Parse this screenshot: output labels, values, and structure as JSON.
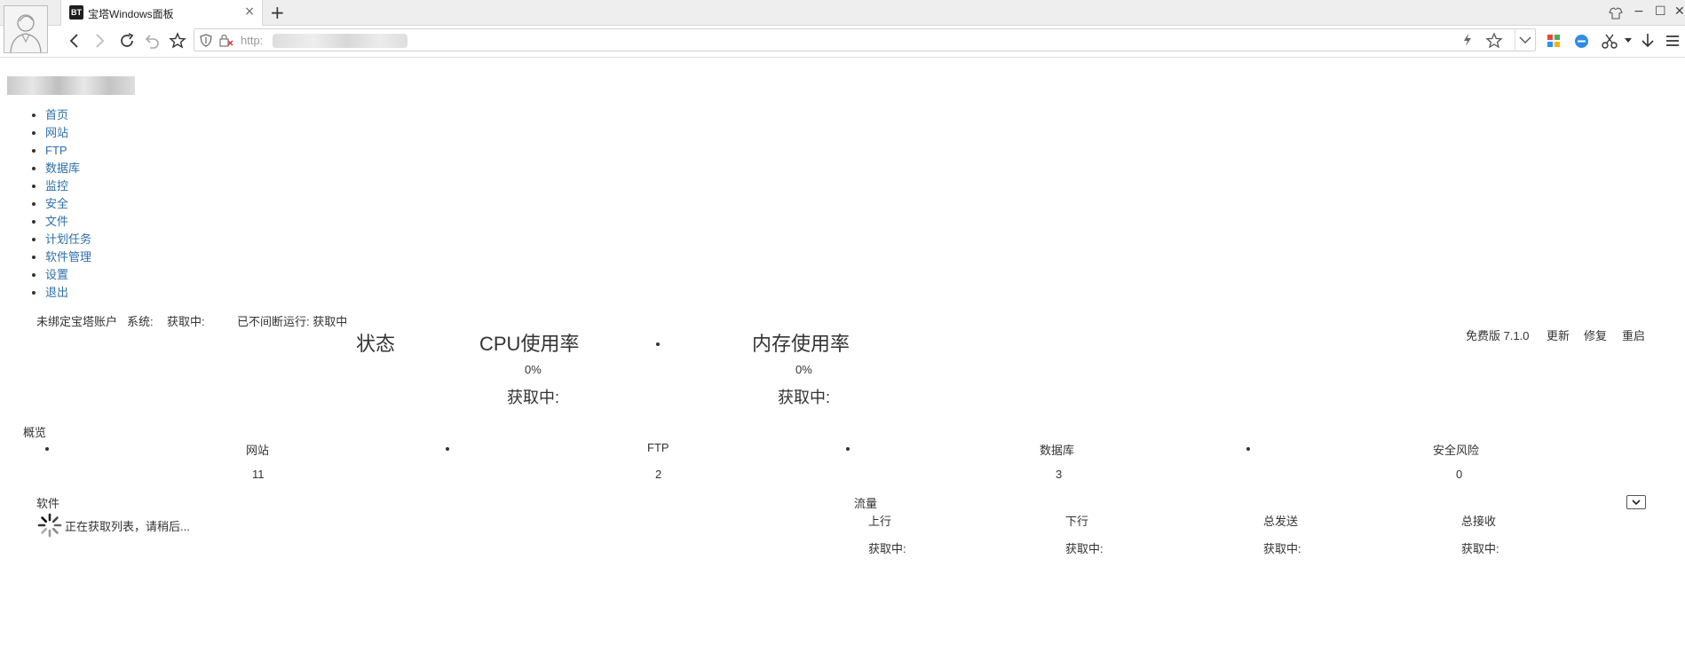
{
  "browser": {
    "tab_title": "宝塔Windows面板",
    "tab_icon_text": "BT",
    "url_scheme": "http:",
    "new_tab": "+",
    "close_tab": "×",
    "window_controls": [
      "−",
      "☐",
      "✕"
    ]
  },
  "menu": [
    "首页",
    "网站",
    "FTP",
    "数据库",
    "监控",
    "安全",
    "文件",
    "计划任务",
    "软件管理",
    "设置",
    "退出"
  ],
  "topline": {
    "account_link": "未绑定宝塔账户",
    "system_label": "系统:",
    "system_value": "获取中:",
    "uptime": "已不间断运行: 获取中"
  },
  "version": {
    "label": "免费版 7.1.0",
    "update": "更新",
    "repair": "修复",
    "restart": "重启"
  },
  "status": {
    "title": "状态",
    "cpu_title": "CPU使用率",
    "cpu_value": "0%",
    "cpu_detail": "获取中:",
    "mem_title": "内存使用率",
    "mem_value": "0%",
    "mem_detail": "获取中:"
  },
  "overview": {
    "title": "概览",
    "items": [
      {
        "label": "网站",
        "value": "11"
      },
      {
        "label": "FTP",
        "value": "2"
      },
      {
        "label": "数据库",
        "value": "3"
      },
      {
        "label": "安全风险",
        "value": "0"
      }
    ]
  },
  "software": {
    "title": "软件",
    "loading": "正在获取列表，请稍后..."
  },
  "traffic": {
    "title": "流量",
    "columns": [
      {
        "label": "上行",
        "value": "获取中:"
      },
      {
        "label": "下行",
        "value": "获取中:"
      },
      {
        "label": "总发送",
        "value": "获取中:"
      },
      {
        "label": "总接收",
        "value": "获取中:"
      }
    ]
  }
}
